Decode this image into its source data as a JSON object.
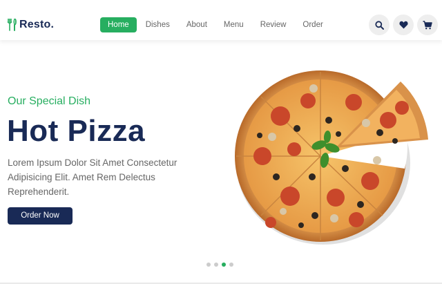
{
  "header": {
    "logo_text": "Resto.",
    "nav": [
      {
        "label": "Home",
        "active": true
      },
      {
        "label": "Dishes",
        "active": false
      },
      {
        "label": "About",
        "active": false
      },
      {
        "label": "Menu",
        "active": false
      },
      {
        "label": "Review",
        "active": false
      },
      {
        "label": "Order",
        "active": false
      }
    ],
    "icons": [
      "search-icon",
      "heart-icon",
      "cart-icon"
    ]
  },
  "hero": {
    "subtitle": "Our Special Dish",
    "title": "Hot Pizza",
    "description": "Lorem Ipsum Dolor Sit Amet Consectetur Adipisicing Elit. Amet Rem Delectus Reprehenderit.",
    "button_label": "Order Now",
    "slider": {
      "total": 4,
      "active_index": 2
    }
  },
  "colors": {
    "brand_green": "#27ae60",
    "navy": "#192a56",
    "text_gray": "#666666"
  }
}
